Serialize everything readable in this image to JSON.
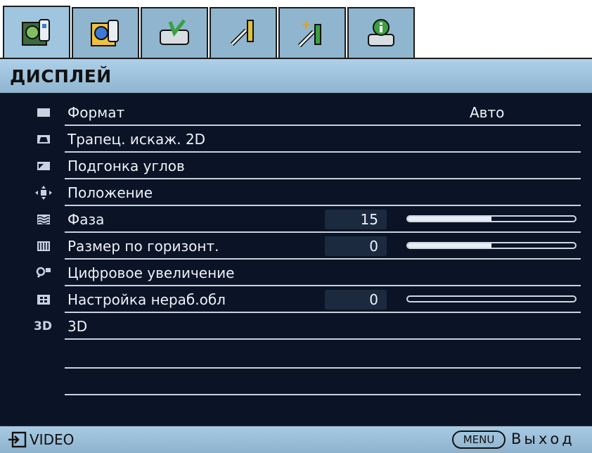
{
  "tabs": [
    {
      "name": "picture-settings-icon",
      "active": true
    },
    {
      "name": "picture-advanced-icon",
      "active": false
    },
    {
      "name": "setup-basic-icon",
      "active": false
    },
    {
      "name": "setup-advanced-tools-icon",
      "active": false
    },
    {
      "name": "system-advanced-icon",
      "active": false
    },
    {
      "name": "information-icon",
      "active": false
    }
  ],
  "title": "ДИСПЛЕЙ",
  "menu": {
    "items": [
      {
        "icon": "aspect-ratio-icon",
        "label": "Формат",
        "value": "Авто"
      },
      {
        "icon": "keystone-icon",
        "label": "Трапец. искаж. 2D"
      },
      {
        "icon": "corner-fit-icon",
        "label": "Подгонка углов"
      },
      {
        "icon": "position-icon",
        "label": "Положение"
      },
      {
        "icon": "phase-icon",
        "label": "Фаза",
        "number": "15",
        "level": 0.5
      },
      {
        "icon": "h-size-icon",
        "label": "Размер по горизонт.",
        "number": "0",
        "level": 0.5
      },
      {
        "icon": "digital-zoom-icon",
        "label": "Цифровое увеличение"
      },
      {
        "icon": "overscan-icon",
        "label": "Настройка нераб.обл",
        "number": "0",
        "level": 0
      },
      {
        "icon": "3d-icon",
        "icon_text": "3D",
        "label": "3D"
      }
    ]
  },
  "status": {
    "source": "VIDEO",
    "menu_button": "MENU",
    "exit": "Выход"
  },
  "colors": {
    "menu_bg": "#0b1426",
    "header_bg": "#9fc5df",
    "text": "#eef2f8"
  }
}
